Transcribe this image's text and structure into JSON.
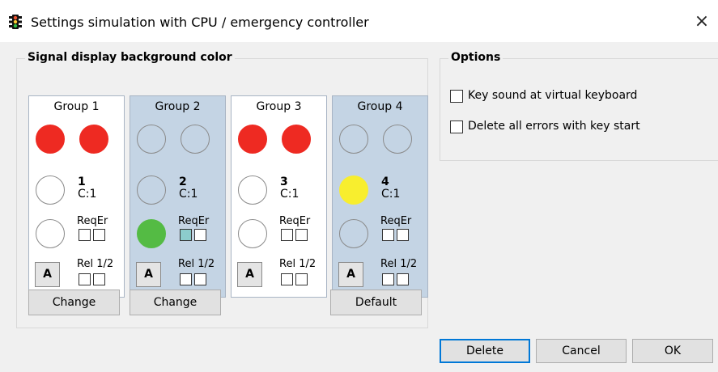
{
  "window": {
    "title": "Settings simulation with CPU / emergency controller",
    "close_glyph": "×",
    "icon": "traffic-light-icon"
  },
  "signal_box": {
    "title": "Signal display background color",
    "groups": [
      {
        "title": "Group 1",
        "number": "1",
        "counter": "C:1",
        "req_label": "ReqEr",
        "rel_label": "Rel 1/2",
        "a_label": "A",
        "req_checked": [
          false,
          false
        ],
        "rel_checked": [
          false,
          false
        ]
      },
      {
        "title": "Group 2",
        "number": "2",
        "counter": "C:1",
        "req_label": "ReqEr",
        "rel_label": "Rel 1/2",
        "a_label": "A",
        "req_checked": [
          true,
          false
        ],
        "rel_checked": [
          false,
          false
        ]
      },
      {
        "title": "Group 3",
        "number": "3",
        "counter": "C:1",
        "req_label": "ReqEr",
        "rel_label": "Rel 1/2",
        "a_label": "A",
        "req_checked": [
          false,
          false
        ],
        "rel_checked": [
          false,
          false
        ]
      },
      {
        "title": "Group 4",
        "number": "4",
        "counter": "C:1",
        "req_label": "ReqEr",
        "rel_label": "Rel 1/2",
        "a_label": "A",
        "req_checked": [
          false,
          false
        ],
        "rel_checked": [
          false,
          false
        ]
      }
    ],
    "buttons": {
      "change_1": "Change",
      "change_2": "Change",
      "default": "Default"
    }
  },
  "options": {
    "title": "Options",
    "key_sound": {
      "label": "Key sound at virtual keyboard",
      "checked": false
    },
    "delete_errors": {
      "label": "Delete all errors with key start",
      "checked": false
    }
  },
  "footer": {
    "delete": "Delete",
    "cancel": "Cancel",
    "ok": "OK"
  },
  "colors": {
    "red": "#ee2a22",
    "yellow": "#f8ee2e",
    "green": "#54bb44",
    "blue_bg": "#c4d4e4",
    "accent": "#0078d7"
  }
}
